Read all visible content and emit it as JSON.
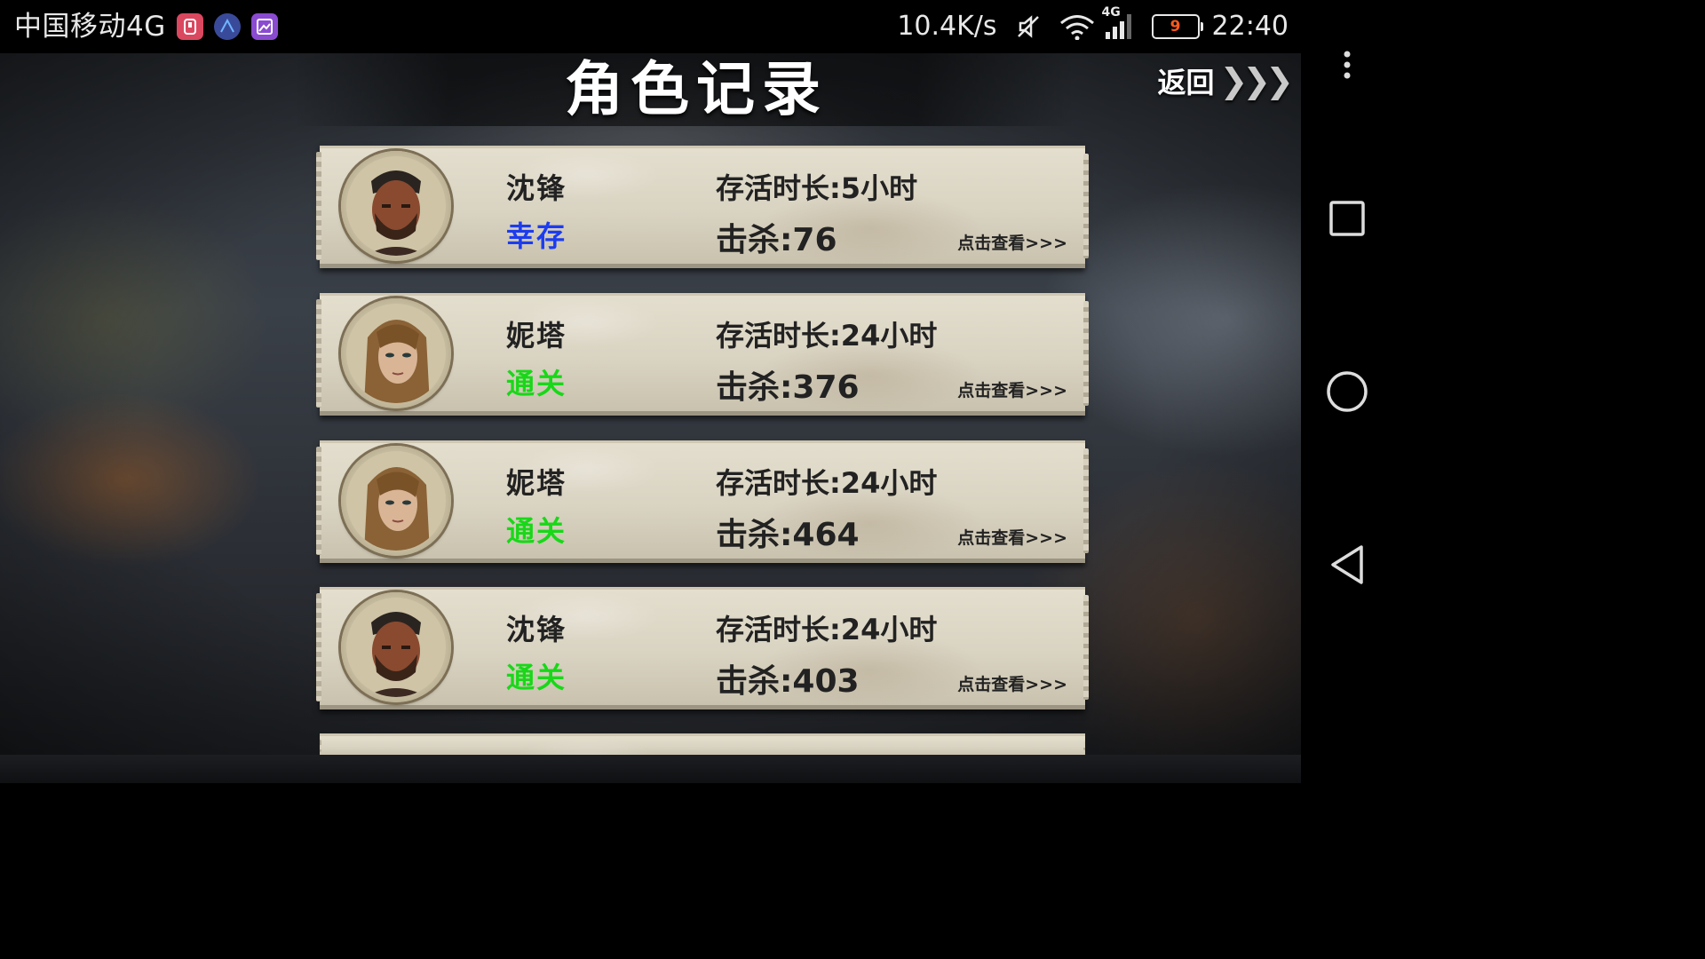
{
  "status_bar": {
    "carrier": "中国移动4G",
    "net_speed": "10.4K/s",
    "network_badge": "4G",
    "battery_level": "9",
    "time": "22:40",
    "icons": [
      "notification-app-icon",
      "notification-browser-icon",
      "notification-gallery-icon",
      "mute-icon",
      "wifi-icon",
      "signal-icon",
      "battery-icon"
    ]
  },
  "header": {
    "title": "角色记录",
    "back_label": "返回",
    "back_chevrons": "❯❯❯"
  },
  "labels": {
    "survival_prefix": "存活时长:",
    "kills_prefix": "击杀:",
    "view_link": "点击查看>>>"
  },
  "records": [
    {
      "name": "沈锋",
      "status": "幸存",
      "status_type": "survived",
      "survival_time": "存活时长:5小时",
      "kills": "击杀:76",
      "avatar": "male-survivor-portrait",
      "view": "点击查看>>>"
    },
    {
      "name": "妮塔",
      "status": "通关",
      "status_type": "cleared",
      "survival_time": "存活时长:24小时",
      "kills": "击杀:376",
      "avatar": "female-survivor-portrait",
      "view": "点击查看>>>"
    },
    {
      "name": "妮塔",
      "status": "通关",
      "status_type": "cleared",
      "survival_time": "存活时长:24小时",
      "kills": "击杀:464",
      "avatar": "female-survivor-portrait",
      "view": "点击查看>>>"
    },
    {
      "name": "沈锋",
      "status": "通关",
      "status_type": "cleared",
      "survival_time": "存活时长:24小时",
      "kills": "击杀:403",
      "avatar": "male-survivor-portrait",
      "view": "点击查看>>>"
    }
  ],
  "colors": {
    "status_survived": "#1c3cf0",
    "status_cleared": "#18d818",
    "card_paper": "#ddd6c5",
    "battery_text": "#ff5a1a"
  },
  "nav_bar": {
    "icons": [
      "more-options-icon",
      "recent-apps-icon",
      "home-icon",
      "back-nav-icon"
    ]
  }
}
